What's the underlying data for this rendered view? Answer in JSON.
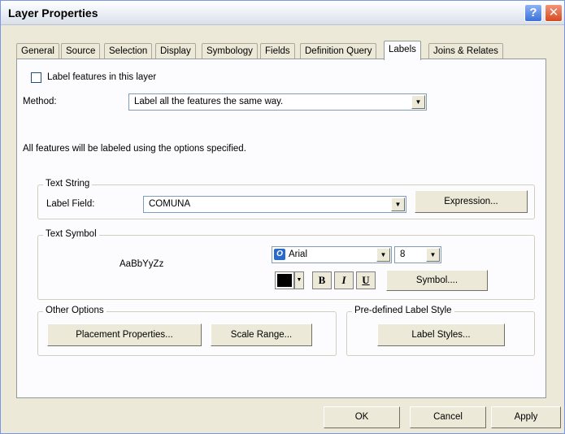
{
  "window": {
    "title": "Layer Properties",
    "help_glyph": "?",
    "close_glyph": "✕"
  },
  "tabs": [
    {
      "label": "General"
    },
    {
      "label": "Source"
    },
    {
      "label": "Selection"
    },
    {
      "label": "Display"
    },
    {
      "label": "Symbology"
    },
    {
      "label": "Fields"
    },
    {
      "label": "Definition Query"
    },
    {
      "label": "Labels",
      "active": true
    },
    {
      "label": "Joins & Relates"
    }
  ],
  "labels_tab": {
    "label_features_checkbox": {
      "label": "Label features in this layer",
      "checked": false
    },
    "method_label": "Method:",
    "method_value": "Label all the features the same way.",
    "info_text": "All features will be labeled using the options specified.",
    "text_string": {
      "group_title": "Text String",
      "label_field_label": "Label Field:",
      "label_field_value": "COMUNA",
      "expression_button": "Expression..."
    },
    "text_symbol": {
      "group_title": "Text Symbol",
      "preview_text": "AaBbYyZz",
      "font_value": "Arial",
      "font_icon": "O",
      "size_value": "8",
      "color": "#000000",
      "bold_label": "B",
      "italic_label": "I",
      "underline_label": "U",
      "symbol_button": "Symbol...."
    },
    "other_options": {
      "group_title": "Other Options",
      "placement_button": "Placement Properties...",
      "scale_button": "Scale Range..."
    },
    "predefined": {
      "group_title": "Pre-defined Label Style",
      "label_styles_button": "Label Styles..."
    }
  },
  "footer": {
    "ok_button": "OK",
    "cancel_button": "Cancel",
    "apply_button": "Apply"
  },
  "colors": {
    "dialog_bg": "#ece9d8",
    "panel_bg": "#fcfcfe",
    "close_button": "#d7491f",
    "help_button": "#3d71d8"
  }
}
